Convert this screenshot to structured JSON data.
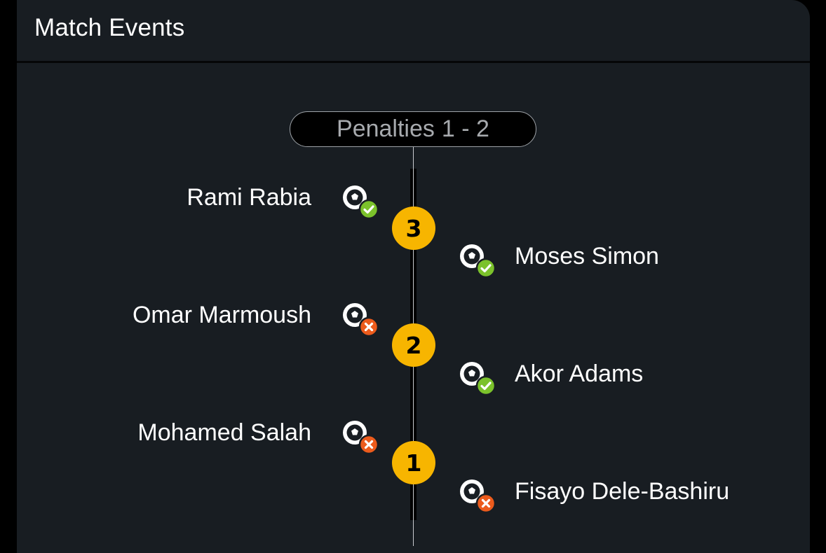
{
  "header": {
    "title": "Match Events"
  },
  "penalties": {
    "label": "Penalties",
    "score": "1 - 2"
  },
  "colors": {
    "scored": "#7bc22b",
    "missed": "#ec5b1c",
    "round_badge": "#f7b500"
  },
  "rounds": [
    {
      "number": "3",
      "left": {
        "player": "Rami Rabia",
        "result": "scored",
        "icon": "penalty-scored-icon"
      },
      "right": {
        "player": "Moses Simon",
        "result": "scored",
        "icon": "penalty-scored-icon"
      }
    },
    {
      "number": "2",
      "left": {
        "player": "Omar Marmoush",
        "result": "missed",
        "icon": "penalty-missed-icon"
      },
      "right": {
        "player": "Akor Adams",
        "result": "scored",
        "icon": "penalty-scored-icon"
      }
    },
    {
      "number": "1",
      "left": {
        "player": "Mohamed Salah",
        "result": "missed",
        "icon": "penalty-missed-icon"
      },
      "right": {
        "player": "Fisayo Dele-Bashiru",
        "result": "missed",
        "icon": "penalty-missed-icon"
      }
    }
  ]
}
